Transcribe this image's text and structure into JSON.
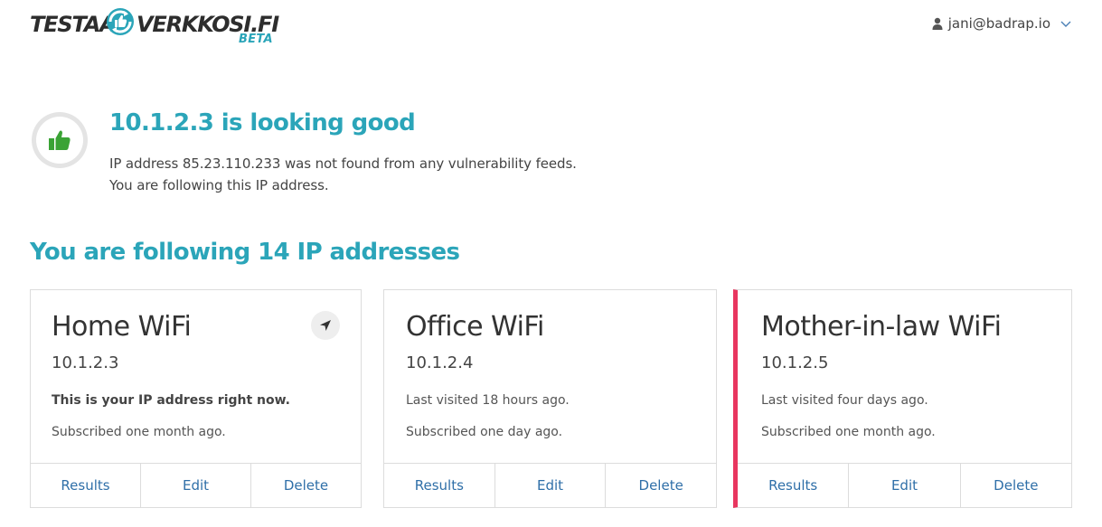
{
  "header": {
    "logo": {
      "left_text": "TESTAA",
      "right_text": "VERKKOSI.FI",
      "badge": "BETA"
    },
    "user": {
      "email": "jani@badrap.io",
      "icon": "user-icon",
      "dropdown_icon": "chevron-down-icon"
    }
  },
  "status": {
    "icon": "thumbs-up-icon",
    "title": "10.1.2.3 is looking good",
    "line1": "IP address 85.23.110.233 was not found from any vulnerability feeds.",
    "line2": "You are following this IP address."
  },
  "section": {
    "title": "You are following 14 IP addresses"
  },
  "cards": [
    {
      "name": "Home WiFi",
      "ip": "10.1.2.3",
      "note": "This is your IP address right now.",
      "subscribed": "Subscribed one month ago.",
      "locate_icon": "location-arrow-icon",
      "actions": {
        "results": "Results",
        "edit": "Edit",
        "delete": "Delete"
      }
    },
    {
      "name": "Office WiFi",
      "ip": "10.1.2.4",
      "note": "Last visited 18 hours ago.",
      "subscribed": "Subscribed one day ago.",
      "actions": {
        "results": "Results",
        "edit": "Edit",
        "delete": "Delete"
      }
    },
    {
      "name": "Mother-in-law WiFi",
      "ip": "10.1.2.5",
      "note": "Last visited four days ago.",
      "subscribed": "Subscribed one month ago.",
      "alert_color": "#e8365f",
      "actions": {
        "results": "Results",
        "edit": "Edit",
        "delete": "Delete"
      }
    }
  ],
  "colors": {
    "accent": "#2ba5b9",
    "link": "#2f6fa8",
    "alert": "#e8365f",
    "good": "#3aa335"
  }
}
